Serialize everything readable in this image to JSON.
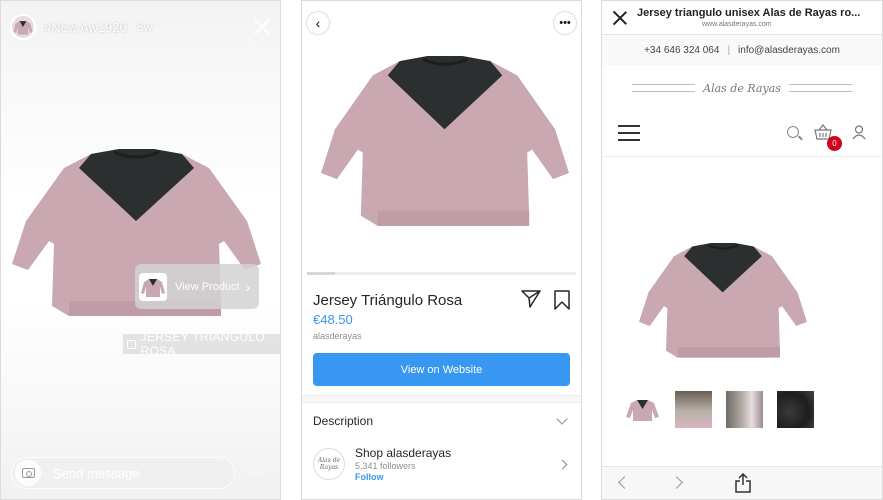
{
  "story": {
    "username": "#New Aw1920",
    "time": "8w",
    "view_product_label": "View Product",
    "product_tag": "JERSEY TRIÁNGULO ROSA",
    "message_placeholder": "Send message",
    "more_label": "···"
  },
  "product": {
    "title": "Jersey Triángulo Rosa",
    "price": "€48.50",
    "seller": "alasderayas",
    "view_website_label": "View on Website",
    "description_label": "Description",
    "shop_name": "Shop alasderayas",
    "shop_followers": "5,341 followers",
    "follow_label": "Follow",
    "shop_logo_text": "Alas de Rayas",
    "more_label": "•••"
  },
  "website": {
    "page_title": "Jersey triangulo unisex Alas de Rayas ro...",
    "url": "www.alasderayas.com",
    "phone": "+34 646 324 064",
    "email": "info@alasderayas.com",
    "contact_separator": "|",
    "brand_name": "Alas de Rayas",
    "cart_count": "0"
  },
  "colors": {
    "sweater_body": "#c9a8b1",
    "sweater_yoke": "#2b2f2f",
    "accent_blue": "#3897f0",
    "badge_red": "#d0021b"
  }
}
